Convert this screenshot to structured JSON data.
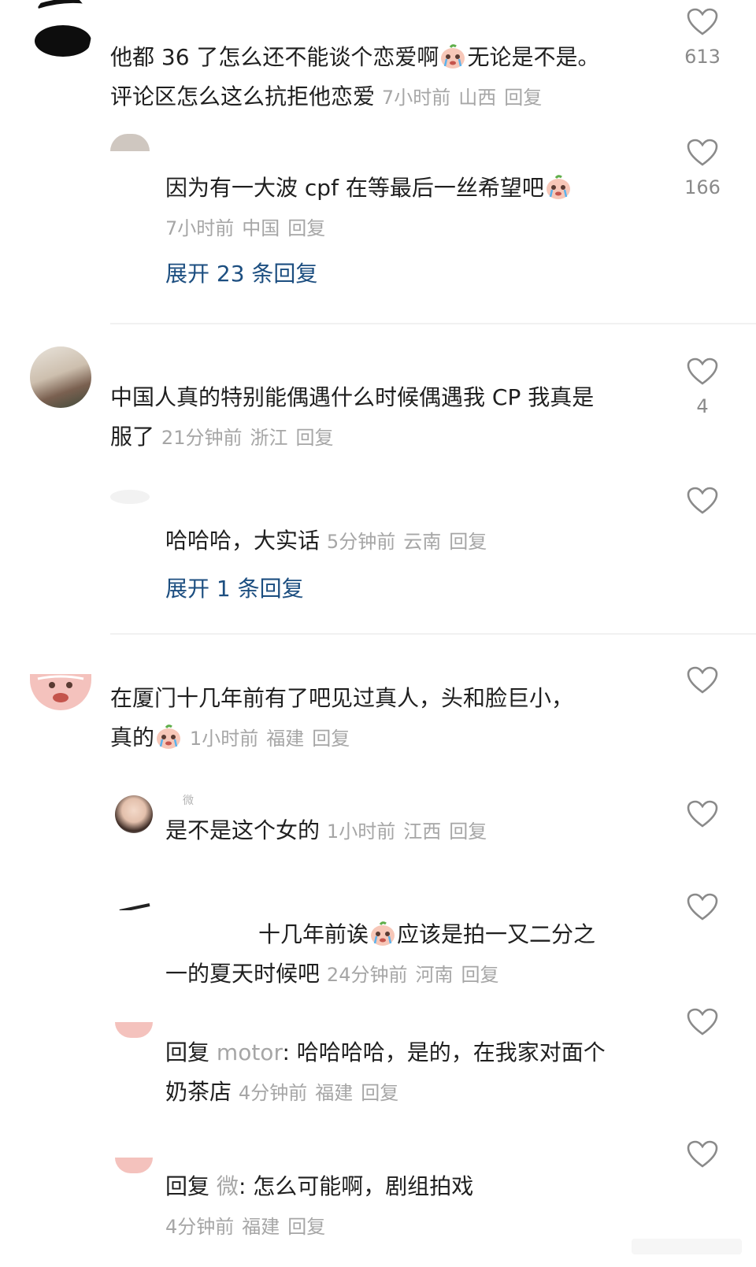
{
  "accent_color": "#1c4e80",
  "meta_color": "#a6a6a6",
  "icons": {
    "like": "heart-outline-icon",
    "emoji": "crying-peach-emoji"
  },
  "comments": [
    {
      "text_a": "他都 36 了怎么还不能谈个恋爱啊",
      "text_b": "无论是不是。",
      "text_c": "评论区怎么这么抗拒他恋爱",
      "time": "7小时前",
      "region": "山西",
      "reply": "回复",
      "likes": "613"
    },
    {
      "text_a": "因为有一大波 cpf 在等最后一丝希望吧",
      "time": "7小时前",
      "region": "中国",
      "reply": "回复",
      "likes": "166",
      "expand": "展开 23 条回复"
    },
    {
      "text_a": "中国人真的特别能偶遇什么时候偶遇我 CP 我真是",
      "text_b": "服了",
      "time": "21分钟前",
      "region": "浙江",
      "reply": "回复",
      "likes": "4"
    },
    {
      "text_a": "哈哈哈，大实话",
      "time": "5分钟前",
      "region": "云南",
      "reply": "回复",
      "expand": "展开 1 条回复"
    },
    {
      "text_a": "在厦门十几年前有了吧见过真人，头和脸巨小，",
      "text_b": "真的",
      "time": "1小时前",
      "region": "福建",
      "reply": "回复"
    },
    {
      "name": "微",
      "text_a": "是不是这个女的",
      "time": "1小时前",
      "region": "江西",
      "reply": "回复"
    },
    {
      "text_a": "十几年前诶",
      "text_b": "应该是拍一又二分之",
      "text_c": "一的夏天时候吧",
      "time": "24分钟前",
      "region": "河南",
      "reply": "回复"
    },
    {
      "reply_prefix": "回复",
      "mention": "motor",
      "text_a": ": 哈哈哈哈，是的，在我家对面个",
      "text_b": "奶茶店",
      "time": "4分钟前",
      "region": "福建",
      "reply": "回复"
    },
    {
      "reply_prefix": "回复",
      "mention": "微",
      "text_a": ": 怎么可能啊，剧组拍戏",
      "time": "4分钟前",
      "region": "福建",
      "reply": "回复"
    }
  ]
}
